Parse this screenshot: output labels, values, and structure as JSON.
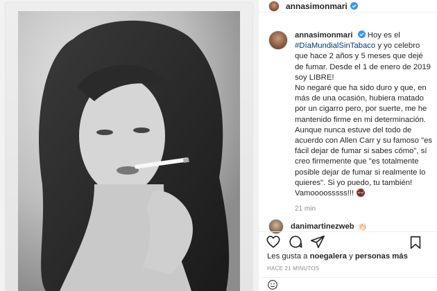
{
  "post": {
    "username": "annasimonmari",
    "caption_intro": "Hoy es el",
    "hashtag": "#DíaMundialSinTabaco",
    "caption_after_hashtag": "y yo celebro que hace 2 años y 5 meses que dejé de fumar. Desde el 1 de enero de 2019 soy LIBRE!",
    "caption_p2": "No negaré que ha sido duro y que, en más de una ocasión, hubiera matado por un cigarro pero, por suerte, me he mantenido firme en mi determinación.",
    "caption_p3": "Aunque nunca estuve del todo de acuerdo con Allen Carr y su famoso \"es fácil dejar de fumar si sabes cómo\", sí creo firmemente que \"es totalmente posible dejar de fumar si realmente lo quieres\". Si yo puedo, tu también! Vamoooosssss!!! 🚭",
    "timestamp": "21 min"
  },
  "reply": {
    "username": "danimartinezweb",
    "emoji": "👏🏻"
  },
  "likes": {
    "prefix": "Les gusta a",
    "user": "noegalera",
    "middle": "y",
    "others": "personas más"
  },
  "time_ago": "HACE 21 MINUTOS",
  "icons": {
    "like": "heart-icon",
    "comment": "comment-icon",
    "share": "share-icon",
    "save": "bookmark-icon",
    "emoji": "smiley-icon"
  },
  "colors": {
    "verified": "#3897f0",
    "hashtag": "#00376b",
    "muted": "#8e8e8e"
  }
}
